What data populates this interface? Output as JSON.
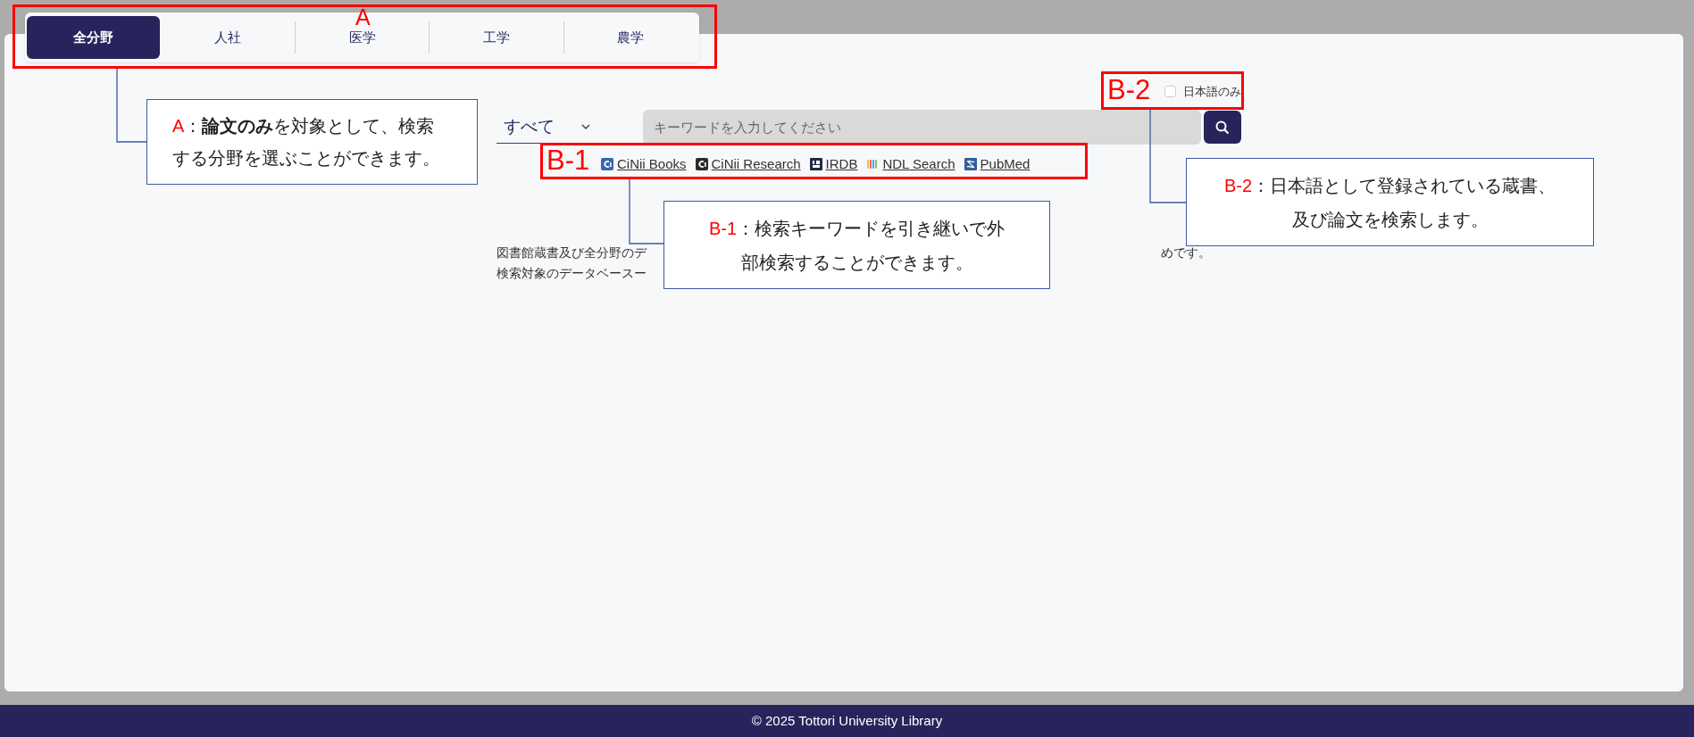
{
  "tabs": [
    {
      "label": "全分野",
      "selected": true
    },
    {
      "label": "人社",
      "selected": false
    },
    {
      "label": "医学",
      "selected": false
    },
    {
      "label": "工学",
      "selected": false
    },
    {
      "label": "農学",
      "selected": false
    }
  ],
  "scope_select": {
    "value": "すべて"
  },
  "japanese_only": {
    "label": "日本語のみ",
    "checked": false
  },
  "search": {
    "placeholder": "キーワードを入力してください"
  },
  "external_links": [
    {
      "label": "CiNii Books",
      "kind": "cinii-books"
    },
    {
      "label": "CiNii Research",
      "kind": "cinii-research"
    },
    {
      "label": "IRDB",
      "kind": "irdb"
    },
    {
      "label": "NDL Search",
      "kind": "ndl"
    },
    {
      "label": "PubMed",
      "kind": "pubmed"
    }
  ],
  "description": {
    "line_1_start": "図書館蔵書及び全分野のデ",
    "line_1_end": "めです。",
    "line_2_start": "検索対象のデータベースー"
  },
  "highlights": [
    {
      "label": "A"
    },
    {
      "label": "B-1"
    },
    {
      "label": "B-2"
    }
  ],
  "callouts": [
    {
      "marker": "A",
      "text": "：**論文のみ**を対象として、検索する分野を選ぶことができます。"
    },
    {
      "marker": "B-1",
      "text": "：検索キーワードを引き継いで外部検索することができます。"
    },
    {
      "marker": "B-2",
      "text": "：日本語として登録されている蔵書、及び論文を検索します。"
    }
  ],
  "footer": "© 2025 Tottori University Library"
}
